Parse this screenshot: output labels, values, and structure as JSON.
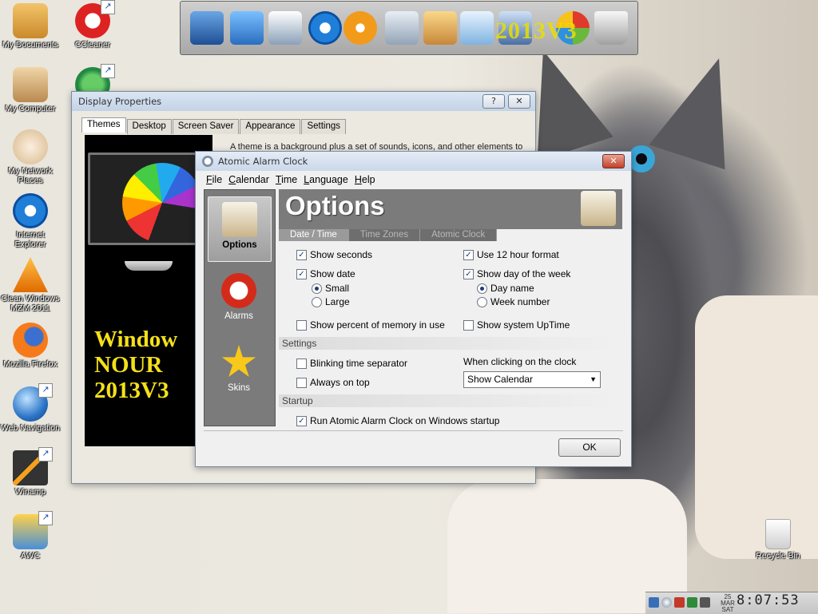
{
  "desktop": {
    "icons": [
      {
        "label": "My Documents"
      },
      {
        "label": "CCleaner"
      },
      {
        "label": "My Computer"
      },
      {
        "label": "My Network Places"
      },
      {
        "label": "Internet Explorer"
      },
      {
        "label": "Clean Windows MZM 2011"
      },
      {
        "label": "Mozilla Firefox"
      },
      {
        "label": "Web Navigation"
      },
      {
        "label": "Winamp"
      },
      {
        "label": "AWC"
      },
      {
        "label": "Recycle Bin"
      }
    ],
    "watermark": "2013V3"
  },
  "display_properties": {
    "title": "Display Properties",
    "help_btn": "?",
    "close_btn": "✕",
    "tabs": [
      "Themes",
      "Desktop",
      "Screen Saver",
      "Appearance",
      "Settings"
    ],
    "intro": "A theme is a background plus a set of sounds, icons, and other elements to",
    "preview_lines": [
      "Window",
      "NOUR",
      "2013V3"
    ]
  },
  "alarm_clock": {
    "title": "Atomic Alarm Clock",
    "close_btn": "✕",
    "menu": [
      "File",
      "Calendar",
      "Time",
      "Language",
      "Help"
    ],
    "sidebar": [
      {
        "label": "Options",
        "active": true
      },
      {
        "label": "Alarms",
        "active": false
      },
      {
        "label": "Skins",
        "active": false
      }
    ],
    "header": "Options",
    "subtabs": [
      {
        "label": "Date / Time",
        "active": true
      },
      {
        "label": "Time Zones",
        "active": false
      },
      {
        "label": "Atomic Clock",
        "active": false
      }
    ],
    "options": {
      "show_seconds": "Show seconds",
      "use_12h": "Use 12 hour format",
      "show_date": "Show date",
      "show_day_of_week": "Show day of the week",
      "small": "Small",
      "large": "Large",
      "day_name": "Day name",
      "week_number": "Week number",
      "show_percent_memory": "Show percent of memory in use",
      "show_uptime": "Show system UpTime"
    },
    "settings_section": "Settings",
    "settings": {
      "blinking": "Blinking time separator",
      "always_on_top": "Always on top",
      "when_clicking": "When clicking on the clock",
      "click_action": "Show Calendar"
    },
    "startup_section": "Startup",
    "startup": {
      "run_on_startup": "Run Atomic Alarm Clock on Windows startup"
    },
    "ok": "OK"
  },
  "tray": {
    "time": "8:07:53",
    "date_day": "25",
    "date_month": "MAR",
    "date_weekday": "SAT"
  }
}
